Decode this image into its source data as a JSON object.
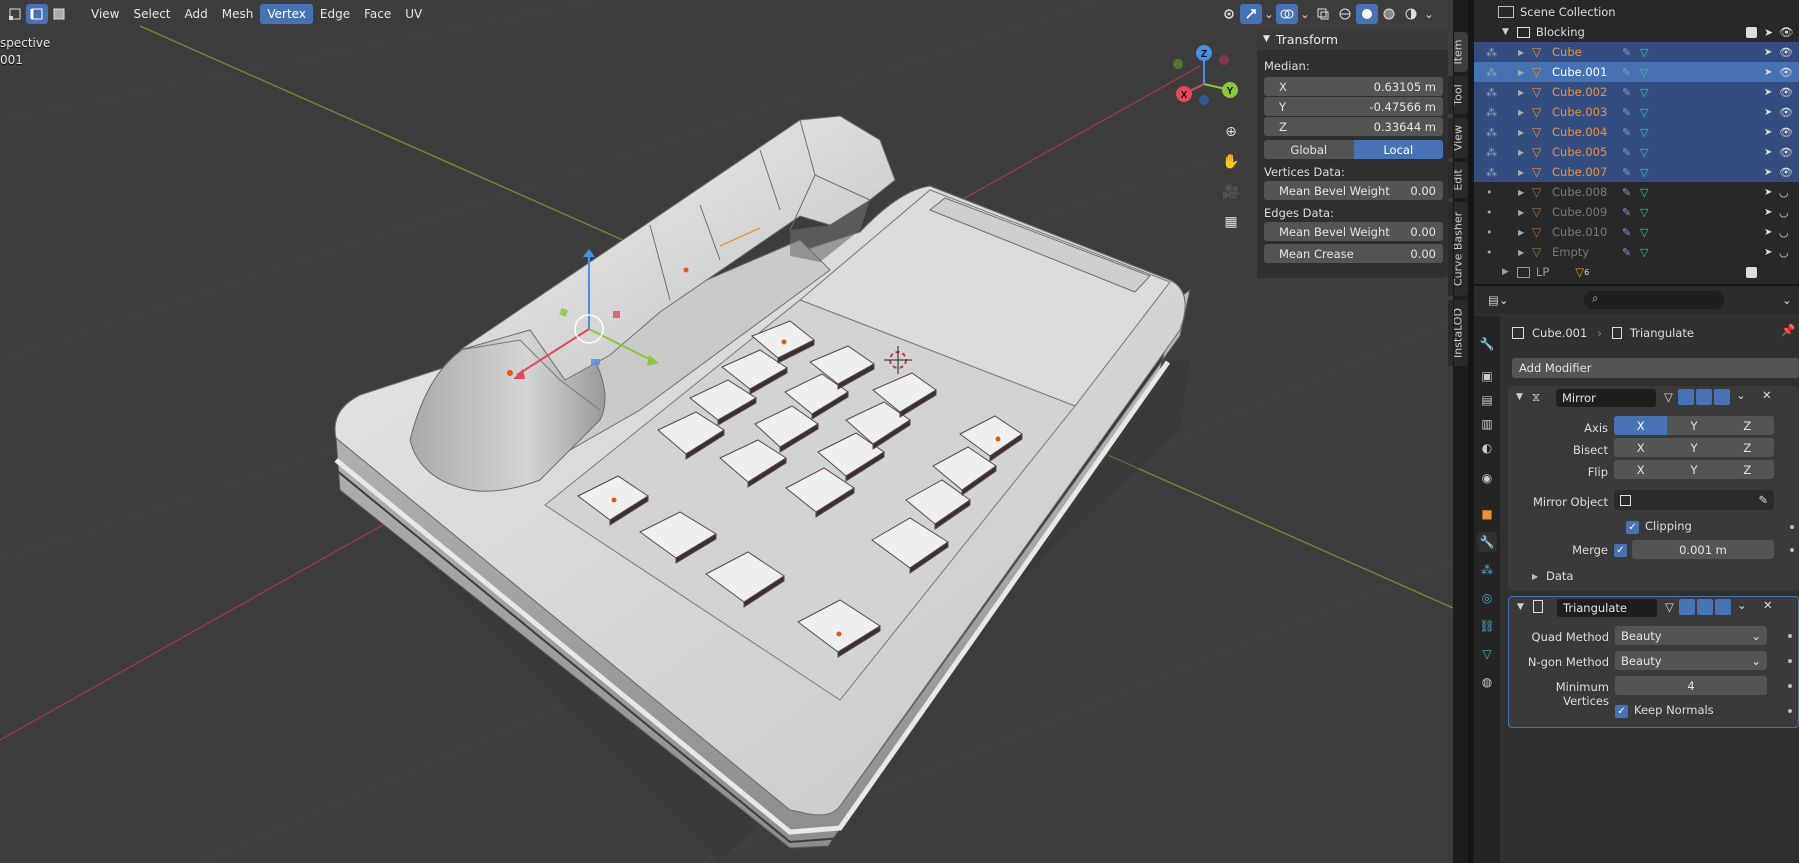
{
  "viewport": {
    "header_menus": [
      "View",
      "Select",
      "Add",
      "Mesh",
      "Vertex",
      "Edge",
      "Face",
      "UV"
    ],
    "active_menu": "Vertex",
    "overlay_text": [
      "spective",
      "001"
    ]
  },
  "npanel": {
    "title": "Transform",
    "median_label": "Median:",
    "fields": [
      {
        "label": "X",
        "value": "0.63105 m"
      },
      {
        "label": "Y",
        "value": "-0.47566 m"
      },
      {
        "label": "Z",
        "value": "0.33644 m"
      }
    ],
    "space": {
      "global": "Global",
      "local": "Local",
      "active": "Local"
    },
    "vertices_label": "Vertices Data:",
    "vertices_fields": [
      {
        "label": "Mean Bevel Weight",
        "value": "0.00"
      }
    ],
    "edges_label": "Edges Data:",
    "edges_fields": [
      {
        "label": "Mean Bevel Weight",
        "value": "0.00"
      },
      {
        "label": "Mean Crease",
        "value": "0.00"
      }
    ],
    "tabs": [
      "Item",
      "Tool",
      "View",
      "Edit",
      "Curve Basher",
      "InstaLOD"
    ],
    "active_tab": "Item"
  },
  "outliner": {
    "title": "Scene Collection",
    "collection": "Blocking",
    "items": [
      {
        "name": "Cube",
        "state": "selected"
      },
      {
        "name": "Cube.001",
        "state": "active"
      },
      {
        "name": "Cube.002",
        "state": "selected"
      },
      {
        "name": "Cube.003",
        "state": "selected"
      },
      {
        "name": "Cube.004",
        "state": "selected"
      },
      {
        "name": "Cube.005",
        "state": "selected"
      },
      {
        "name": "Cube.007",
        "state": "selected"
      },
      {
        "name": "Cube.008",
        "state": "disabled"
      },
      {
        "name": "Cube.009",
        "state": "disabled"
      },
      {
        "name": "Cube.010",
        "state": "disabled"
      },
      {
        "name": "Empty",
        "state": "disabled"
      }
    ],
    "collection2": "LP",
    "collection2_badge": "6"
  },
  "properties": {
    "object_name": "Cube.001",
    "modifier_context": "Triangulate",
    "add_modifier": "Add Modifier",
    "mirror": {
      "name": "Mirror",
      "axis_label": "Axis",
      "bisect_label": "Bisect",
      "flip_label": "Flip",
      "axes": [
        "X",
        "Y",
        "Z"
      ],
      "mirror_object_label": "Mirror Object",
      "clipping_label": "Clipping",
      "merge_label": "Merge",
      "merge_value": "0.001 m",
      "data_label": "Data"
    },
    "triangulate": {
      "name": "Triangulate",
      "quad_label": "Quad Method",
      "quad_value": "Beauty",
      "ngon_label": "N-gon Method",
      "ngon_value": "Beauty",
      "minverts_label": "Minimum Vertices",
      "minverts_value": "4",
      "keep_normals_label": "Keep Normals"
    }
  },
  "colors": {
    "accent": "#4772b3",
    "selected_row": "#334d80",
    "object_orange": "#e8923a",
    "x_axis": "#e24a5c",
    "y_axis": "#8cc63f",
    "z_axis": "#4a8ee6"
  }
}
